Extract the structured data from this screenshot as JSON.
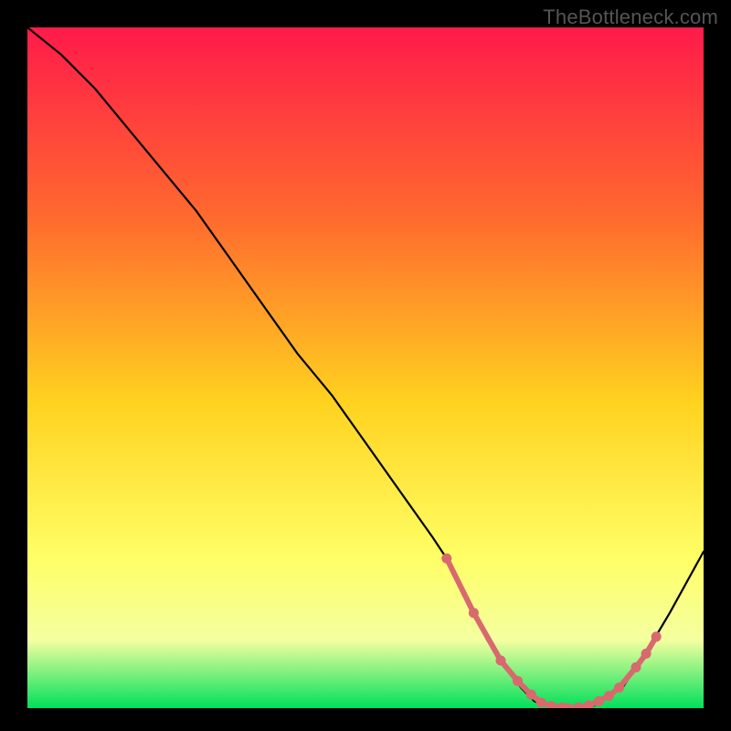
{
  "watermark": "TheBottleneck.com",
  "colors": {
    "background": "#000000",
    "gradient_top": "#ff1a4a",
    "gradient_mid_upper": "#ff6a2e",
    "gradient_mid": "#ffd21f",
    "gradient_mid_lower": "#ffff66",
    "gradient_lower": "#f4ffa0",
    "gradient_bottom": "#00e05a",
    "curve": "#000000",
    "markers": "#d8696f"
  },
  "chart_data": {
    "type": "line",
    "title": "",
    "xlabel": "",
    "ylabel": "",
    "xlim": [
      0,
      100
    ],
    "ylim": [
      0,
      100
    ],
    "series": [
      {
        "name": "bottleneck-curve",
        "x": [
          0,
          5,
          10,
          15,
          20,
          25,
          30,
          35,
          40,
          45,
          50,
          55,
          60,
          62,
          65,
          68,
          70,
          73,
          75,
          78,
          80,
          83,
          85,
          88,
          90,
          92,
          95,
          100
        ],
        "y": [
          100,
          96,
          91,
          85,
          79,
          73,
          66,
          59,
          52,
          46,
          39,
          32,
          25,
          22,
          16,
          10,
          7,
          3,
          1,
          0,
          0,
          0,
          1,
          3,
          6,
          9,
          14,
          23
        ]
      }
    ],
    "markers": {
      "name": "highlight-points",
      "x": [
        62,
        66,
        70,
        72.5,
        74.5,
        76,
        77.5,
        79,
        80,
        81.5,
        83,
        84.5,
        86,
        87.5,
        90,
        91.5,
        93
      ],
      "y": [
        22,
        14,
        7,
        4,
        2,
        0.8,
        0.3,
        0.1,
        0,
        0.1,
        0.4,
        1.0,
        1.8,
        3.0,
        6.0,
        8.0,
        10.5
      ]
    }
  }
}
